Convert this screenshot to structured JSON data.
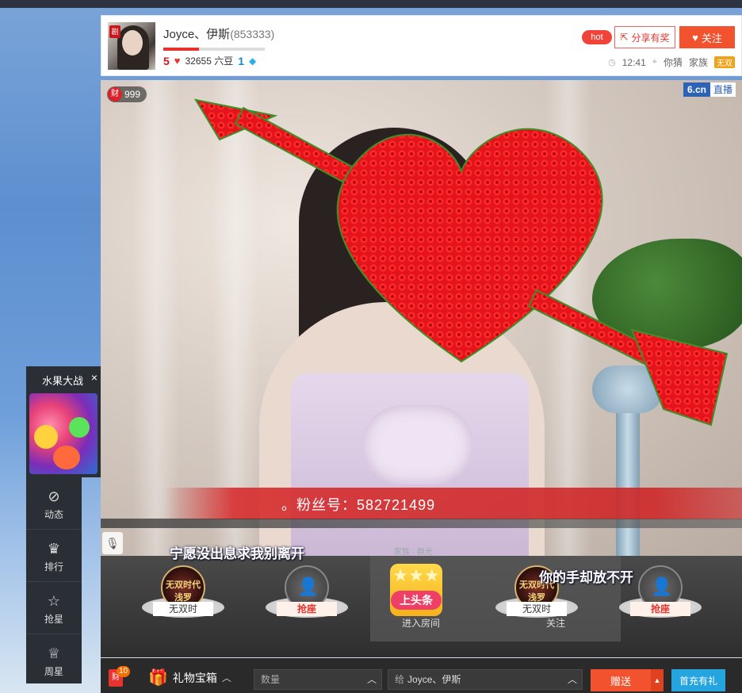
{
  "header": {
    "anchor_name": "Joyce、伊斯",
    "room_id": "(853333)",
    "progress_fraction": 0.35,
    "level": "5",
    "beans": "32655 六豆",
    "star_level": "1",
    "hot_label": "hot",
    "share_label": "分享有奖",
    "follow_label": "关注",
    "time": "12:41",
    "location": "你猜",
    "family_label": "家族",
    "family_badge": "无双"
  },
  "video": {
    "wealth_icon": "财",
    "wealth_value": "999",
    "logo": "6.cn",
    "live_label": "直播",
    "fan_number_text": "。粉丝号：582721499"
  },
  "seats": {
    "seat1_crest": "无双时代 浅罗",
    "seat1_label": "无双时",
    "seat2_label": "抢座",
    "headline_label": "上头条",
    "seat3_crest": "无双时代 浅罗",
    "seat3_label": "无双时",
    "seat4_label": "抢座",
    "room_faint": "家族 · 群光",
    "room_left": "进入房间",
    "room_right": "关注"
  },
  "lyrics": {
    "line1": "宁愿没出息求我别离开",
    "line2": "你的手却放不开"
  },
  "bottombar": {
    "wealth_icon": "财",
    "wealth_count": "10",
    "gift_box_label": "礼物宝箱",
    "quantity_placeholder": "数量",
    "to_prefix": "给",
    "to_name": "Joyce、伊斯",
    "send_label": "赠送",
    "recharge_label": "首充有礼"
  },
  "game_panel": {
    "title": "水果大战",
    "close": "×"
  },
  "sidenav": {
    "items": [
      {
        "label": "动态",
        "icon": "compass-icon"
      },
      {
        "label": "排行",
        "icon": "crown-icon"
      },
      {
        "label": "抢星",
        "icon": "star-icon"
      },
      {
        "label": "周星",
        "icon": "trophy-icon"
      }
    ]
  },
  "colors": {
    "accent": "#f2532e",
    "heart_red": "#e8322d",
    "recharge_blue": "#25a5e0"
  }
}
